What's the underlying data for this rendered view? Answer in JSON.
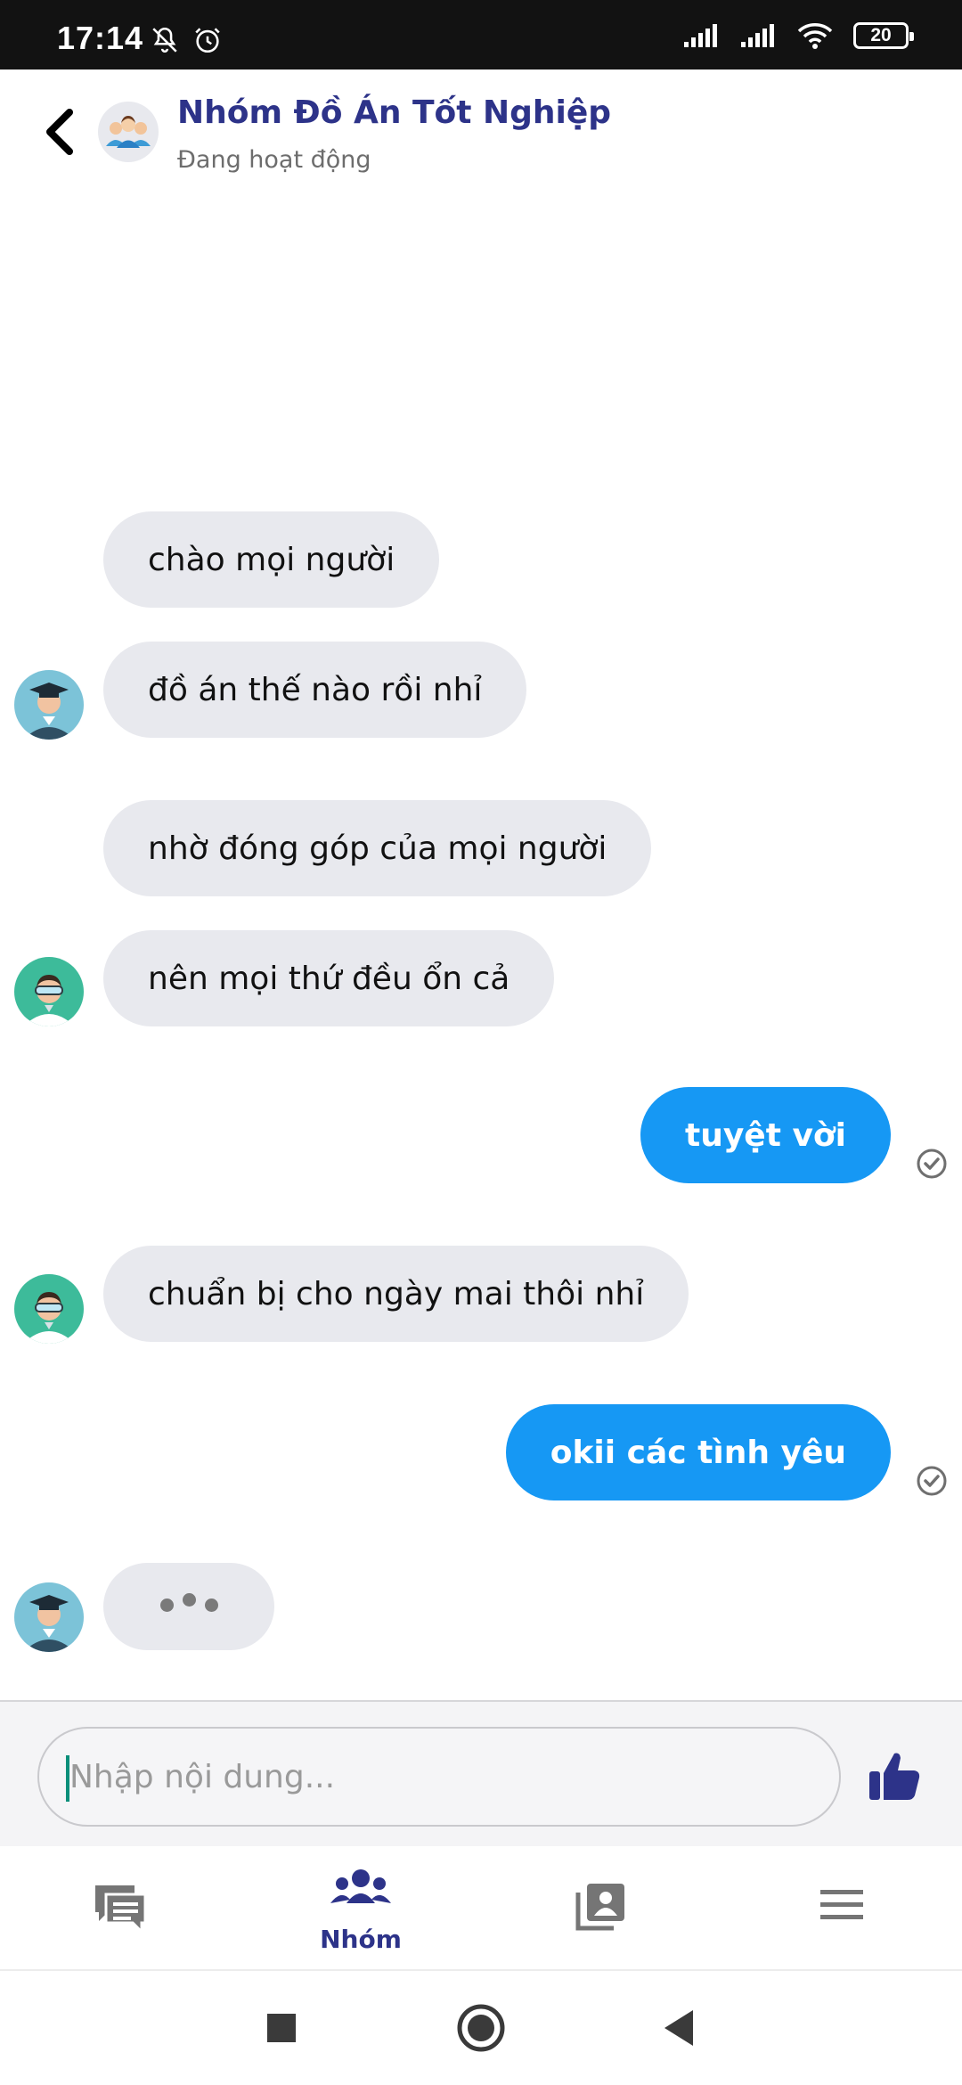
{
  "status_bar": {
    "time": "17:14",
    "battery": "20",
    "icons": [
      "bell-off-icon",
      "alarm-icon",
      "signal-icon",
      "signal-icon",
      "wifi-icon",
      "battery-icon"
    ]
  },
  "header": {
    "title": "Nhóm Đồ Án Tốt Nghiệp",
    "status": "Đang hoạt động",
    "back_icon": "chevron-left-icon",
    "avatar_icon": "group-avatar-icon"
  },
  "messages": [
    {
      "direction": "incoming",
      "text": "chào mọi người"
    },
    {
      "direction": "incoming",
      "text": "đồ án thế nào rồi nhỉ",
      "avatar": "graduate-avatar"
    },
    {
      "direction": "incoming",
      "text": "nhờ đóng góp của mọi người"
    },
    {
      "direction": "incoming",
      "text": "nên mọi thứ đều ổn cả",
      "avatar": "goggles-avatar"
    },
    {
      "direction": "outgoing",
      "text": "tuyệt vời",
      "status_icon": "check-circle-icon"
    },
    {
      "direction": "incoming",
      "text": "chuẩn bị cho ngày mai thôi nhỉ",
      "avatar": "goggles-avatar"
    },
    {
      "direction": "outgoing",
      "text": "okii các tình yêu",
      "status_icon": "check-circle-icon"
    },
    {
      "direction": "incoming",
      "typing": true,
      "avatar": "graduate-avatar"
    }
  ],
  "composer": {
    "placeholder": "Nhập nội dung...",
    "value": "",
    "send_icon": "thumbs-up-icon"
  },
  "bottom_nav": {
    "active": "groups",
    "items": [
      {
        "id": "chats",
        "icon": "chat-icon",
        "label": ""
      },
      {
        "id": "groups",
        "icon": "group-icon",
        "label": "Nhóm"
      },
      {
        "id": "contacts",
        "icon": "contacts-icon",
        "label": ""
      },
      {
        "id": "menu",
        "icon": "menu-icon",
        "label": ""
      }
    ]
  },
  "colors": {
    "accent": "#2d3389",
    "outgoing_bubble": "#1698f4",
    "incoming_bubble": "#e8e9ee",
    "status_bar": "#121212"
  }
}
